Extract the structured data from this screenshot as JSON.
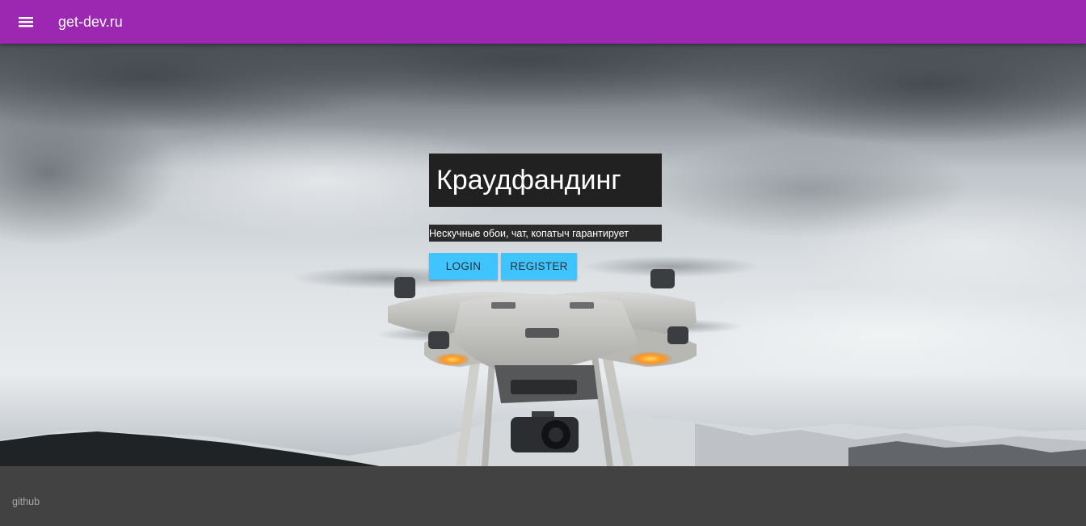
{
  "header": {
    "brand": "get-dev.ru",
    "menu_icon": "menu-icon"
  },
  "hero": {
    "background_image": "drone-over-snowy-mountains",
    "title": "Краудфандинг",
    "subtitle": "Нескучные обои, чат, копатыч гарантирует",
    "login_label": "LOGIN",
    "register_label": "REGISTER"
  },
  "footer": {
    "link": "github"
  },
  "colors": {
    "appbar": "#9c27b0",
    "button": "#40c4ff",
    "footer": "#424242",
    "title_box": "#212121"
  }
}
